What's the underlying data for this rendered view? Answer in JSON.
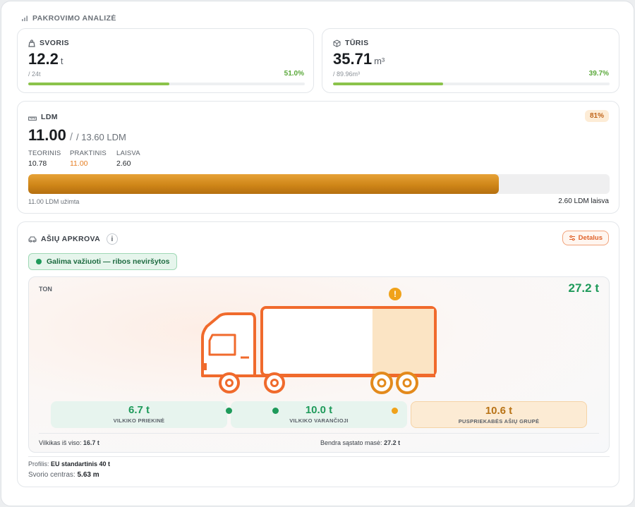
{
  "header": {
    "title": "PAKROVIMO ANALIZĖ",
    "icon": "bar-chart-icon"
  },
  "weight": {
    "label": "SVORIS",
    "value": "12.2",
    "unit": "t",
    "capacity": "/ 24t",
    "percent_text": "51.0%",
    "fill_fraction": 0.51,
    "icon": "weight-icon"
  },
  "volume": {
    "label": "TŪRIS",
    "value": "35.71",
    "unit": "m³",
    "capacity": "/ 89.96m³",
    "percent_text": "39.7%",
    "fill_fraction": 0.397,
    "icon": "box-icon"
  },
  "ldm": {
    "label": "LDM",
    "badge": "81%",
    "value": "11.00",
    "separator": "/",
    "total": "/ 13.60 LDM",
    "stats": [
      {
        "label": "TEORINIS",
        "value": "10.78"
      },
      {
        "label": "PRAKTINIS",
        "value": "11.00"
      },
      {
        "label": "LAISVA",
        "value": "2.60"
      }
    ],
    "fill_fraction": 0.809,
    "used_text": "11.00 LDM užimta",
    "free_text": "2.60 LDM laisva",
    "icon": "ruler-icon"
  },
  "axle": {
    "label": "AŠIŲ APKROVA",
    "info": "i",
    "details_button": "Detalus",
    "status": "Galima važiuoti — ribos neviršytos",
    "unit_label": "TON",
    "total": "27.2 t",
    "warning": "!",
    "load_fraction": 0.36,
    "groups": [
      {
        "value": "6.7 t",
        "name": "VILKIKO PRIEKINĖ",
        "status": "ok"
      },
      {
        "value": "10.0 t",
        "name": "VILKIKO VARANČIOJI",
        "status": "ok"
      },
      {
        "value": "10.6 t",
        "name": "PUSPRIEKABĖS AŠIŲ GRUPĖ",
        "status": "warning"
      }
    ],
    "tractor_total_label": "Vilkikas iš viso:",
    "tractor_total_value": "16.7 t",
    "combo_total_label": "Bendra sąstato masė:",
    "combo_total_value": "27.2 t"
  },
  "footer": {
    "profile_label": "Profilis:",
    "profile_value": "EU standartinis 40 t",
    "cog_label": "Svorio centras:",
    "cog_value": "5.63 m"
  },
  "colors": {
    "green": "#1e9a5a",
    "orange": "#e67e22",
    "truck": "#f06a2c",
    "amber": "#c88016",
    "bar_green": "#8bc34a"
  }
}
